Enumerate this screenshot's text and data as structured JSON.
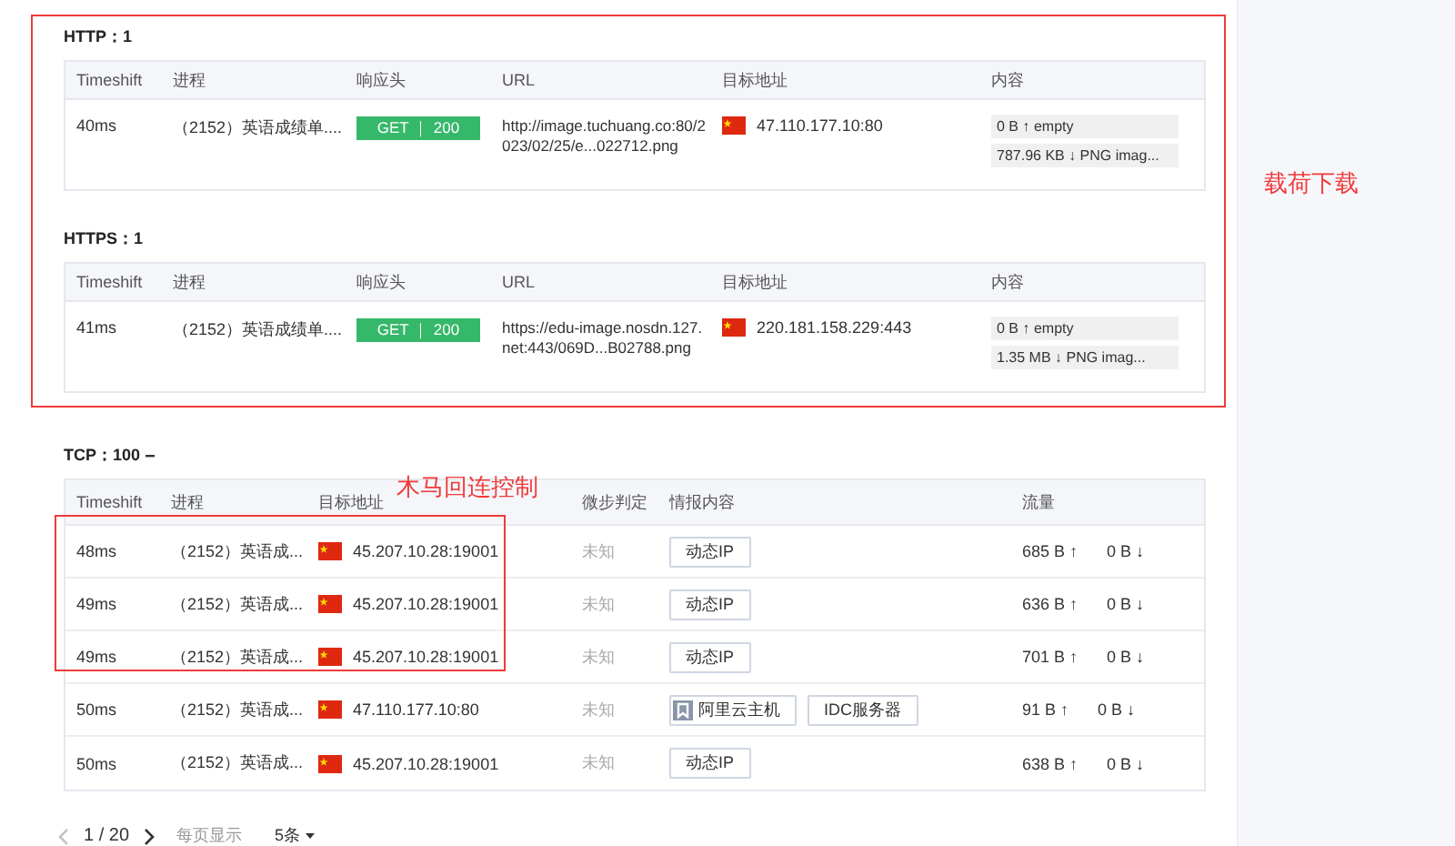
{
  "http_sections": [
    {
      "title": "HTTP：1",
      "columns": [
        "Timeshift",
        "进程",
        "响应头",
        "URL",
        "目标地址",
        "内容"
      ],
      "rows": [
        {
          "timeshift": "40ms",
          "process": "（2152）英语成绩单....",
          "badge": "GET ｜ 200",
          "url": "http://image.tuchuang.co:80/2023/02/25/e...022712.png",
          "address": "47.110.177.10:80",
          "content": [
            "0 B ↑ empty",
            "787.96 KB ↓ PNG imag..."
          ]
        }
      ]
    },
    {
      "title": "HTTPS：1",
      "columns": [
        "Timeshift",
        "进程",
        "响应头",
        "URL",
        "目标地址",
        "内容"
      ],
      "rows": [
        {
          "timeshift": "41ms",
          "process": "（2152）英语成绩单....",
          "badge": "GET ｜ 200",
          "url": "https://edu-image.nosdn.127.net:443/069D...B02788.png",
          "address": "220.181.158.229:443",
          "content": [
            "0 B ↑ empty",
            "1.35 MB ↓ PNG imag..."
          ]
        }
      ]
    }
  ],
  "tcp_section": {
    "title": "TCP：100",
    "columns": [
      "Timeshift",
      "进程",
      "目标地址",
      "微步判定",
      "情报内容",
      "流量"
    ],
    "rows": [
      {
        "timeshift": "48ms",
        "process": "（2152）英语成...",
        "address": "45.207.10.28:19001",
        "verdict": "未知",
        "tags": [
          {
            "kind": "plain",
            "text": "动态IP"
          }
        ],
        "up": "685 B ↑",
        "down": "0 B ↓"
      },
      {
        "timeshift": "49ms",
        "process": "（2152）英语成...",
        "address": "45.207.10.28:19001",
        "verdict": "未知",
        "tags": [
          {
            "kind": "plain",
            "text": "动态IP"
          }
        ],
        "up": "636 B ↑",
        "down": "0 B ↓"
      },
      {
        "timeshift": "49ms",
        "process": "（2152）英语成...",
        "address": "45.207.10.28:19001",
        "verdict": "未知",
        "tags": [
          {
            "kind": "plain",
            "text": "动态IP"
          }
        ],
        "up": "701 B ↑",
        "down": "0 B ↓"
      },
      {
        "timeshift": "50ms",
        "process": "（2152）英语成...",
        "address": "47.110.177.10:80",
        "verdict": "未知",
        "tags": [
          {
            "kind": "cloud",
            "text": "阿里云主机"
          },
          {
            "kind": "plain",
            "text": "IDC服务器"
          }
        ],
        "up": "91 B ↑",
        "down": "0 B ↓"
      },
      {
        "timeshift": "50ms",
        "process": "（2152）英语成...",
        "address": "45.207.10.28:19001",
        "verdict": "未知",
        "tags": [
          {
            "kind": "plain",
            "text": "动态IP"
          }
        ],
        "up": "638 B ↑",
        "down": "0 B ↓"
      }
    ]
  },
  "pagination": {
    "prev": {
      "disabled": true
    },
    "page": "1 / 20",
    "next": {
      "disabled": false
    },
    "per_page_label": "每页显示",
    "per_page": "5条"
  },
  "annotations": [
    {
      "label": "载荷下载"
    },
    {
      "label": "木马回连控制"
    }
  ]
}
